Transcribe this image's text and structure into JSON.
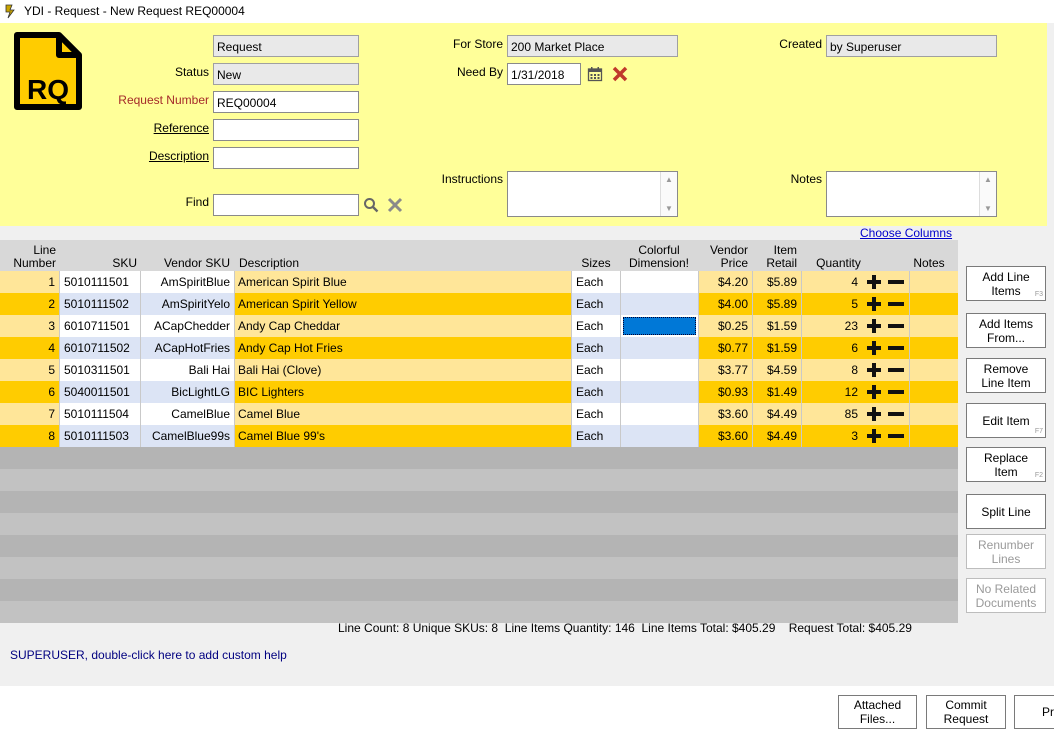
{
  "window": {
    "title": "YDI - Request - New Request REQ00004"
  },
  "header": {
    "doc_icon_text": "RQ",
    "type_value": "Request",
    "status_label": "Status",
    "status_value": "New",
    "request_number_label": "Request Number",
    "request_number_value": "REQ00004",
    "reference_label": "Reference",
    "reference_value": "",
    "description_label": "Description",
    "description_value": "",
    "find_label": "Find",
    "find_value": "",
    "for_store_label": "For Store",
    "for_store_value": "200 Market Place",
    "need_by_label": "Need By",
    "need_by_value": "1/31/2018",
    "created_label": "Created",
    "created_value": "by Superuser",
    "instructions_label": "Instructions",
    "notes_label": "Notes",
    "choose_columns_link": "Choose Columns",
    "colors": {
      "header_bg": "#ffff99",
      "request_number_label": "#a52a2a",
      "link": "#0000cc"
    }
  },
  "grid": {
    "headers": {
      "line_number": [
        "Line",
        "Number"
      ],
      "sku": "SKU",
      "vendor_sku": "Vendor SKU",
      "description": "Description",
      "sizes": "Sizes",
      "dimension": [
        "Colorful",
        "Dimension!"
      ],
      "vendor_price": [
        "Vendor",
        "Price"
      ],
      "item_retail": [
        "Item",
        "Retail"
      ],
      "quantity": "Quantity",
      "notes": "Notes"
    },
    "rows": [
      {
        "line": "1",
        "sku": "5010111501",
        "vendor_sku": "AmSpiritBlue",
        "description": "American Spirit Blue",
        "size": "Each",
        "vendor_price": "$4.20",
        "retail": "$5.89",
        "qty": "4"
      },
      {
        "line": "2",
        "sku": "5010111502",
        "vendor_sku": "AmSpiritYelo",
        "description": "American Spirit Yellow",
        "size": "Each",
        "vendor_price": "$4.00",
        "retail": "$5.89",
        "qty": "5"
      },
      {
        "line": "3",
        "sku": "6010711501",
        "vendor_sku": "ACapChedder",
        "description": "Andy Cap Cheddar",
        "size": "Each",
        "vendor_price": "$0.25",
        "retail": "$1.59",
        "qty": "23"
      },
      {
        "line": "4",
        "sku": "6010711502",
        "vendor_sku": "ACapHotFries",
        "description": "Andy Cap Hot Fries",
        "size": "Each",
        "vendor_price": "$0.77",
        "retail": "$1.59",
        "qty": "6"
      },
      {
        "line": "5",
        "sku": "5010311501",
        "vendor_sku": "Bali Hai",
        "description": "Bali Hai (Clove)",
        "size": "Each",
        "vendor_price": "$3.77",
        "retail": "$4.59",
        "qty": "8"
      },
      {
        "line": "6",
        "sku": "5040011501",
        "vendor_sku": "BicLightLG",
        "description": "BIC Lighters",
        "size": "Each",
        "vendor_price": "$0.93",
        "retail": "$1.49",
        "qty": "12"
      },
      {
        "line": "7",
        "sku": "5010111504",
        "vendor_sku": "CamelBlue",
        "description": "Camel Blue",
        "size": "Each",
        "vendor_price": "$3.60",
        "retail": "$4.49",
        "qty": "85"
      },
      {
        "line": "8",
        "sku": "5010111503",
        "vendor_sku": "CamelBlue99s",
        "description": "Camel Blue 99's",
        "size": "Each",
        "vendor_price": "$3.60",
        "retail": "$4.49",
        "qty": "3"
      }
    ],
    "selected_cell": {
      "row": 3,
      "column": "dimension"
    },
    "colors": {
      "row_odd": "#ffe699",
      "row_even": "#ffcc00",
      "selected": "#0078d7",
      "empty": "#b9b9b9"
    }
  },
  "side_buttons": [
    {
      "label": "Add Line Items",
      "fkey": "F3",
      "enabled": true
    },
    {
      "label": "Add Items From...",
      "fkey": "",
      "enabled": true
    },
    {
      "label": "Remove Line Item",
      "fkey": "",
      "enabled": true
    },
    {
      "label": "Edit Item",
      "fkey": "F7",
      "enabled": true
    },
    {
      "label": "Replace Item",
      "fkey": "F2",
      "enabled": true
    },
    {
      "label": "Split Line",
      "fkey": "",
      "enabled": true
    },
    {
      "label": "Renumber Lines",
      "fkey": "",
      "enabled": false
    },
    {
      "label": "No Related Documents",
      "fkey": "",
      "enabled": false
    }
  ],
  "summary": "Line Count: 8 Unique SKUs: 8  Line Items Quantity: 146  Line Items Total: $405.29    Request Total: $405.29",
  "help_text": "SUPERUSER, double-click here to add custom help",
  "footer_buttons": {
    "attached_files": "Attached Files...",
    "commit_request": "Commit Request",
    "print_partial": "Pr"
  }
}
